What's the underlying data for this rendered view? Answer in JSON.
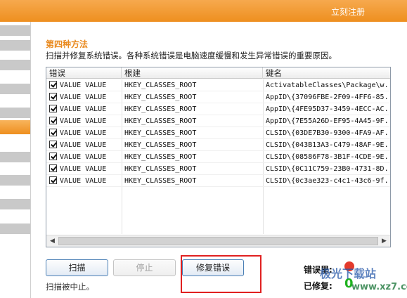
{
  "topbar": {
    "register_label": "立刻注册"
  },
  "heading": {
    "title": "第四种方法",
    "description": "扫描并修复系统错误。各种系统错误是电脑速度缓慢和发生异常错误的重要原因。"
  },
  "list": {
    "columns": [
      "错误",
      "根建",
      "键名"
    ],
    "rows": [
      {
        "checked": true,
        "error": "VALUE VALUE",
        "root": "HKEY_CLASSES_ROOT",
        "key": "ActivatableClasses\\Package\\w..."
      },
      {
        "checked": true,
        "error": "VALUE VALUE",
        "root": "HKEY_CLASSES_ROOT",
        "key": "AppID\\{37096FBE-2F09-4FF6-85..."
      },
      {
        "checked": true,
        "error": "VALUE VALUE",
        "root": "HKEY_CLASSES_ROOT",
        "key": "AppID\\{4FE95D37-3459-4ECC-AC..."
      },
      {
        "checked": true,
        "error": "VALUE VALUE",
        "root": "HKEY_CLASSES_ROOT",
        "key": "AppID\\{7E55A26D-EF95-4A45-9F..."
      },
      {
        "checked": true,
        "error": "VALUE VALUE",
        "root": "HKEY_CLASSES_ROOT",
        "key": "CLSID\\{03DE7B30-9300-4FA9-AF..."
      },
      {
        "checked": true,
        "error": "VALUE VALUE",
        "root": "HKEY_CLASSES_ROOT",
        "key": "CLSID\\{043B13A3-C479-48AF-9E..."
      },
      {
        "checked": true,
        "error": "VALUE VALUE",
        "root": "HKEY_CLASSES_ROOT",
        "key": "CLSID\\{08586F78-3B1F-4CDE-9E..."
      },
      {
        "checked": true,
        "error": "VALUE VALUE",
        "root": "HKEY_CLASSES_ROOT",
        "key": "CLSID\\{0C11C759-23B0-4731-8D..."
      },
      {
        "checked": true,
        "error": "VALUE VALUE",
        "root": "HKEY_CLASSES_ROOT",
        "key": "CLSID\\{0c3ae323-c4c1-43c6-9f..."
      }
    ]
  },
  "buttons": {
    "scan_label": "扫描",
    "stop_label": "停止",
    "fix_label": "修复错误"
  },
  "status_text": "扫描被中止。",
  "stats": {
    "errors_label": "错误里:",
    "fixed_label": "已修复:",
    "fixed_count": "0"
  },
  "watermark": {
    "text": "极光下载站",
    "url": "www.xz7.com"
  },
  "colors": {
    "accent": "#ee8f1f",
    "title": "#e98a1f",
    "highlight": "#e02020",
    "fixed": "#1fb21f"
  }
}
